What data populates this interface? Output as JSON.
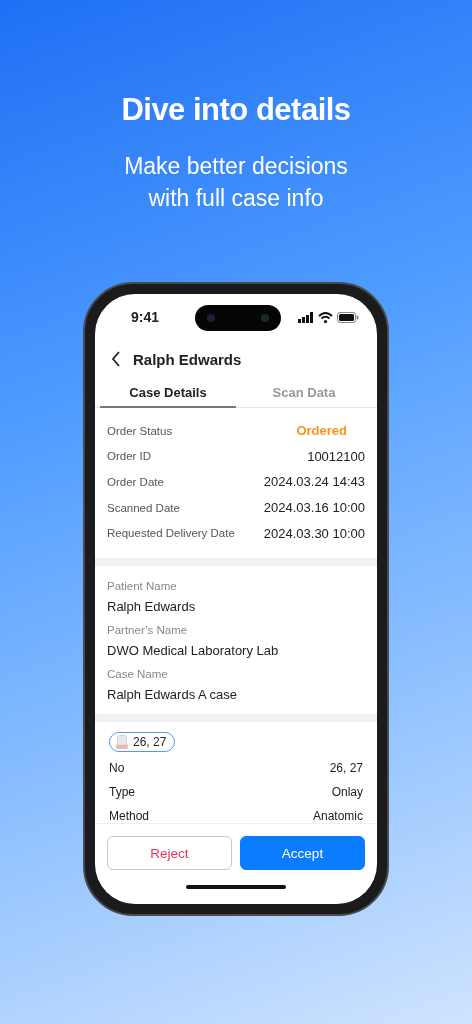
{
  "headline": "Dive into details",
  "subtitle": "Make better decisions with full case info",
  "status_bar": {
    "time": "9:41"
  },
  "header": {
    "title": "Ralph Edwards"
  },
  "tabs": [
    {
      "label": "Case Details",
      "selected": true
    },
    {
      "label": "Scan Data",
      "selected": false
    }
  ],
  "order_info": [
    {
      "label": "Order Status",
      "value": "Ordered",
      "kind": "status"
    },
    {
      "label": "Order ID",
      "value": "10012100",
      "kind": "plain"
    },
    {
      "label": "Order Date",
      "value": "2024.03.24 14:43",
      "kind": "plain"
    },
    {
      "label": "Scanned Date",
      "value": "2024.03.16 10:00",
      "kind": "plain"
    },
    {
      "label": "Requested Delivery Date",
      "value": "2024.03.30 10:00",
      "kind": "plain"
    }
  ],
  "patient_info": [
    {
      "label": "Patient Name",
      "value": "Ralph Edwards"
    },
    {
      "label": "Partner’s Name",
      "value": "DWO Medical Laboratory Lab"
    },
    {
      "label": "Case Name",
      "value": "Ralph Edwards A case"
    }
  ],
  "tooth_chip": {
    "label": "26, 27"
  },
  "tooth_info": [
    {
      "label": "No",
      "value": "26, 27"
    },
    {
      "label": "Type",
      "value": "Onlay"
    },
    {
      "label": "Method",
      "value": "Anatomic"
    }
  ],
  "buttons": [
    {
      "label": "Reject",
      "kind": "secondary"
    },
    {
      "label": "Accept",
      "kind": "primary"
    }
  ]
}
